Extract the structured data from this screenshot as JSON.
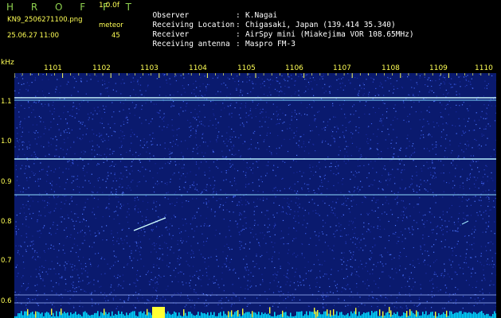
{
  "header": {
    "app_title": "H R O F F T",
    "version": "1.0.0f",
    "filename": "KN9_2506271100.png",
    "mode_label": "meteor",
    "datetime": "25.06.27 11:00",
    "count": "45"
  },
  "info": [
    {
      "label": "Observer",
      "value": "K.Nagai"
    },
    {
      "label": "Receiving Location",
      "value": "Chigasaki, Japan (139.414 35.340)"
    },
    {
      "label": "Receiver",
      "value": "AirSpy mini (Miakejima VOR 108.65MHz)"
    },
    {
      "label": "Receiving antenna",
      "value": "Maspro FM-3"
    }
  ],
  "spectrogram": {
    "y_unit": "kHz",
    "y_ticks": [
      "1.1",
      "1.0",
      "0.9",
      "0.8",
      "0.7",
      "0.6"
    ],
    "x_ticks": [
      "1101",
      "1102",
      "1103",
      "1104",
      "1105",
      "1106",
      "1107",
      "1108",
      "1109",
      "1110"
    ],
    "colors": {
      "background": "#0a1a6e",
      "noise": "#3050d8",
      "line": "#b0f0ff",
      "text": "#ffff55"
    }
  }
}
